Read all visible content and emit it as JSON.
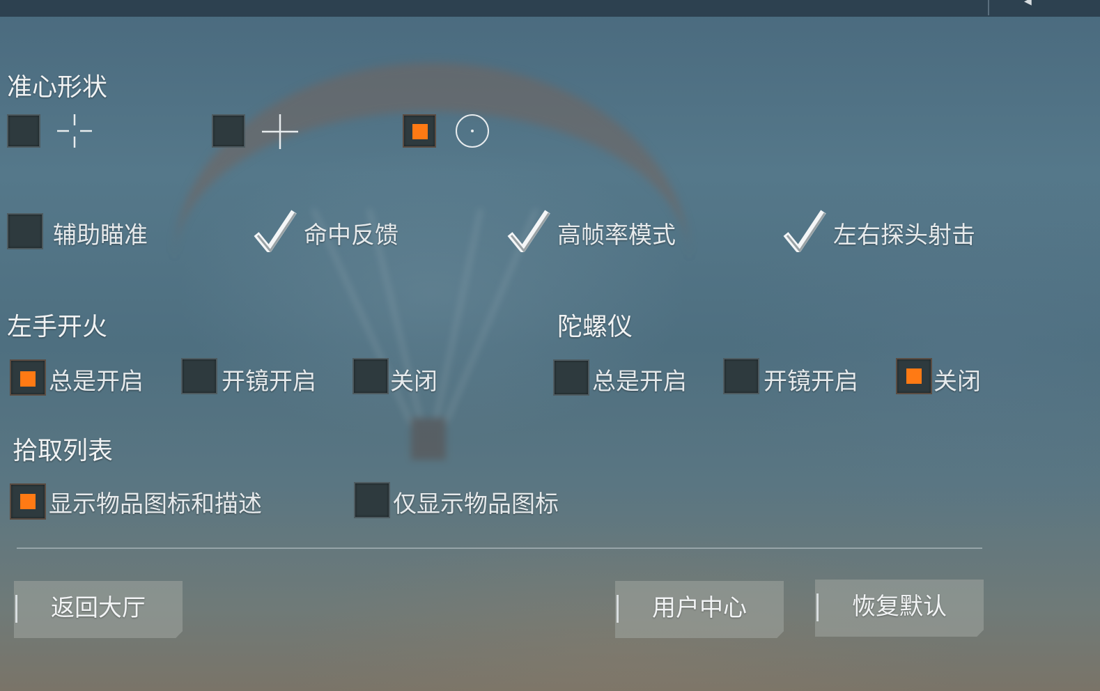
{
  "crosshair": {
    "title": "准心形状",
    "options": [
      {
        "icon": "crosshair-gap-icon",
        "selected": false
      },
      {
        "icon": "crosshair-plus-icon",
        "selected": false
      },
      {
        "icon": "crosshair-circle-dot-icon",
        "selected": true
      }
    ]
  },
  "toggles": [
    {
      "label": "辅助瞄准",
      "checked": false
    },
    {
      "label": "命中反馈",
      "checked": true
    },
    {
      "label": "高帧率模式",
      "checked": true
    },
    {
      "label": "左右探头射击",
      "checked": true
    }
  ],
  "left_fire": {
    "title": "左手开火",
    "options": [
      {
        "label": "总是开启",
        "selected": true
      },
      {
        "label": "开镜开启",
        "selected": false
      },
      {
        "label": "关闭",
        "selected": false
      }
    ]
  },
  "gyro": {
    "title": "陀螺仪",
    "options": [
      {
        "label": "总是开启",
        "selected": false
      },
      {
        "label": "开镜开启",
        "selected": false
      },
      {
        "label": "关闭",
        "selected": true
      }
    ]
  },
  "pickup": {
    "title": "拾取列表",
    "options": [
      {
        "label": "显示物品图标和描述",
        "selected": true
      },
      {
        "label": "仅显示物品图标",
        "selected": false
      }
    ]
  },
  "buttons": {
    "back": "返回大厅",
    "user_center": "用户中心",
    "restore": "恢复默认"
  },
  "colors": {
    "accent": "#ff7a14",
    "box": "#2e3a3e"
  }
}
